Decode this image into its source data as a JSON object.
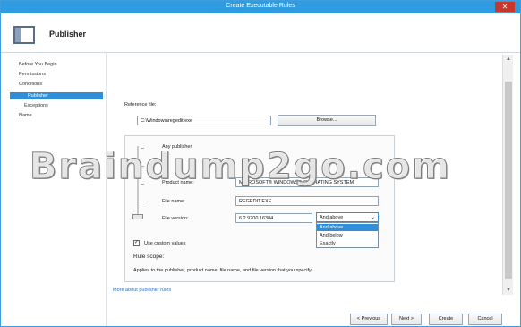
{
  "window": {
    "title": "Create Executable Rules",
    "close_glyph": "✕"
  },
  "header": {
    "title": "Publisher",
    "icon": "publisher-window-icon"
  },
  "nav": {
    "items": [
      {
        "label": "Before You Begin"
      },
      {
        "label": "Permissions"
      },
      {
        "label": "Conditions"
      },
      {
        "label": "Publisher"
      },
      {
        "label": "Exceptions"
      },
      {
        "label": "Name"
      }
    ],
    "selected_color": "#2f8fd8"
  },
  "reference": {
    "label": "Reference file:",
    "value": "C:\\Windows\\regedit.exe",
    "browse_label": "Browse..."
  },
  "slider": {
    "any_publisher_label": "Any publisher",
    "product_name_label": "Product name:",
    "product_name_value": "MICROSOFT® WINDOWS® OPERATING SYSTEM",
    "file_name_label": "File name:",
    "file_name_value": "REGEDIT.EXE",
    "file_version_label": "File version:",
    "file_version_value": "6.2.9200.16384",
    "version_selector": {
      "selected": "And above",
      "options": [
        "And above",
        "And below",
        "Exactly"
      ]
    }
  },
  "custom_values": {
    "checkbox_label": "Use custom values",
    "checked": true
  },
  "rule_scope": {
    "label": "Rule scope:",
    "text": "Applies to the publisher, product name, file name, and file version that you specify."
  },
  "more_link": "More about publisher rules",
  "buttons": {
    "previous": "< Previous",
    "next": "Next >",
    "create": "Create",
    "cancel": "Cancel"
  },
  "watermark": "Braindump2go.com"
}
